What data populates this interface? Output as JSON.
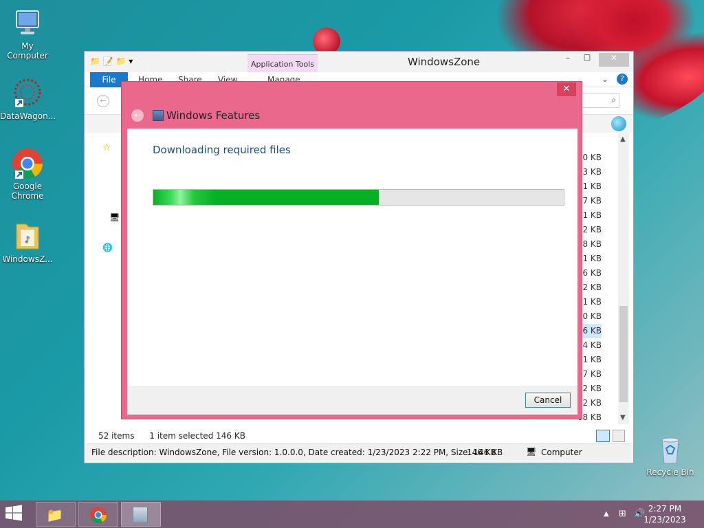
{
  "desktop": {
    "icons": [
      {
        "label": "My Computer"
      },
      {
        "label": "DataWagon..."
      },
      {
        "label": "Google Chrome"
      },
      {
        "label": "WindowsZ..."
      },
      {
        "label": "Recycle Bin"
      }
    ]
  },
  "explorer": {
    "title": "WindowsZone",
    "context_tab": "Application Tools",
    "ribbon_tabs": [
      "File",
      "Home",
      "Share",
      "View",
      "Manage"
    ],
    "sizes": [
      "30 KB",
      "3 KB",
      "1 KB",
      "37 KB",
      "1 KB",
      "22 KB",
      "38 KB",
      "1 KB",
      "6 KB",
      "2 KB",
      "1 KB",
      "20 KB",
      "46 KB",
      "34 KB",
      "1 KB",
      "57 KB",
      "52 KB",
      "2 KB",
      "68 KB"
    ],
    "status_count": "52 items",
    "status_selected": "1 item selected  146 KB",
    "file_description": "File description: WindowsZone, File version: 1.0.0.0, Date created: 1/23/2023 2:22 PM, Size: 146 KB",
    "desc_size": "146 KB",
    "desc_location": "Computer"
  },
  "dialog": {
    "title": "Windows Features",
    "heading": "Downloading required files",
    "progress_fraction": 0.55,
    "cancel_label": "Cancel",
    "close_glyph": "✕"
  },
  "taskbar": {
    "time": "2:27 PM",
    "date": "1/23/2023"
  },
  "colors": {
    "dialog_frame": "#e9688c",
    "progress_green": "#06b025",
    "taskbar": "#78546e"
  }
}
